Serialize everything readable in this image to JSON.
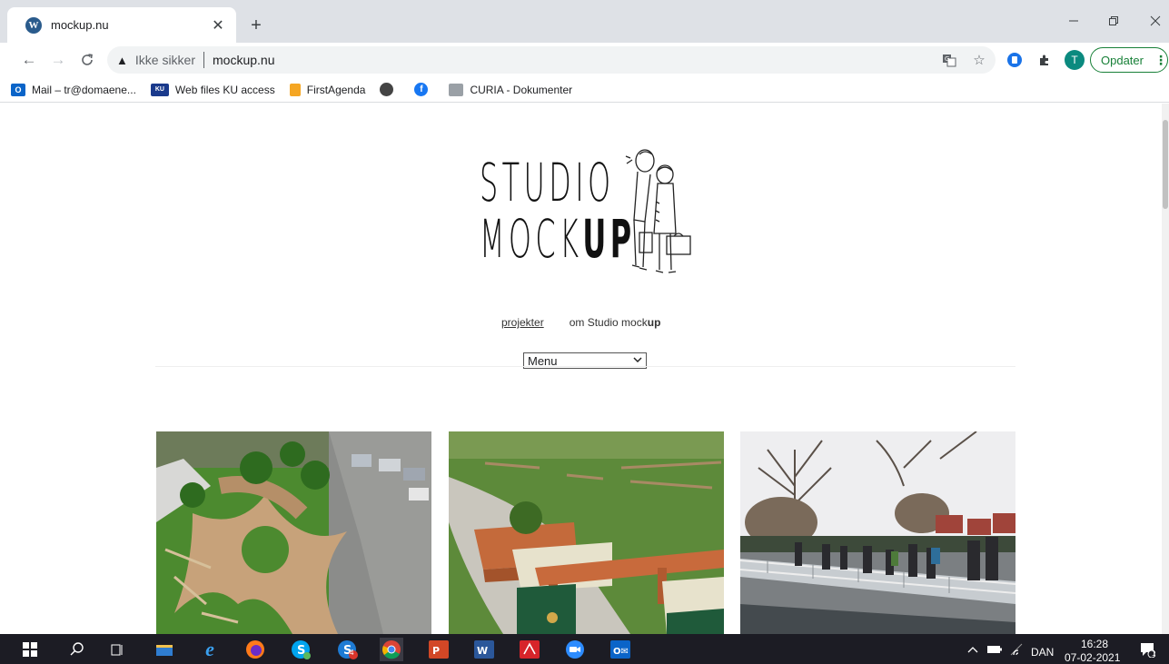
{
  "browser": {
    "tab": {
      "title": "mockup.nu",
      "favicon": "wordpress-icon"
    },
    "window_controls": [
      "minimize-icon",
      "restore-icon",
      "close-icon"
    ],
    "address": {
      "security_label": "Ikke sikker",
      "url": "mockup.nu"
    },
    "profile_initial": "T",
    "update_label": "Opdater",
    "bookmarks": [
      {
        "label": "Mail – tr@domaene...",
        "icon": "outlook-icon",
        "color": "#0a64c8"
      },
      {
        "label": "Web files KU access",
        "icon": "ku-icon",
        "color": "#1a3a8c"
      },
      {
        "label": "FirstAgenda",
        "icon": "firstagenda-icon",
        "color": "#f5a623"
      },
      {
        "label": "",
        "icon": "globe-icon",
        "color": "#444"
      },
      {
        "label": "",
        "icon": "facebook-icon",
        "color": "#1877f2"
      },
      {
        "label": "CURIA - Dokumenter",
        "icon": "curia-icon",
        "color": "#888"
      }
    ]
  },
  "site": {
    "logo": {
      "line1": "STUDIO",
      "line2_a": "MOCK",
      "line2_b": "UP"
    },
    "nav": {
      "projects": "projekter",
      "about_prefix": "om Studio mock",
      "about_bold": "up"
    },
    "menu_select": {
      "selected": "Menu"
    },
    "projects": [
      {
        "name": "playground-aerial"
      },
      {
        "name": "benches-on-lawn"
      },
      {
        "name": "floating-bridge-crowd"
      }
    ]
  },
  "taskbar": {
    "language": "DAN",
    "time": "16:28",
    "date": "07-02-2021",
    "notification_count": "1",
    "skype_badge": "4"
  },
  "colors": {
    "accent_green": "#188038",
    "taskbar": "#1c1c24",
    "tab_strip": "#dee1e6"
  }
}
